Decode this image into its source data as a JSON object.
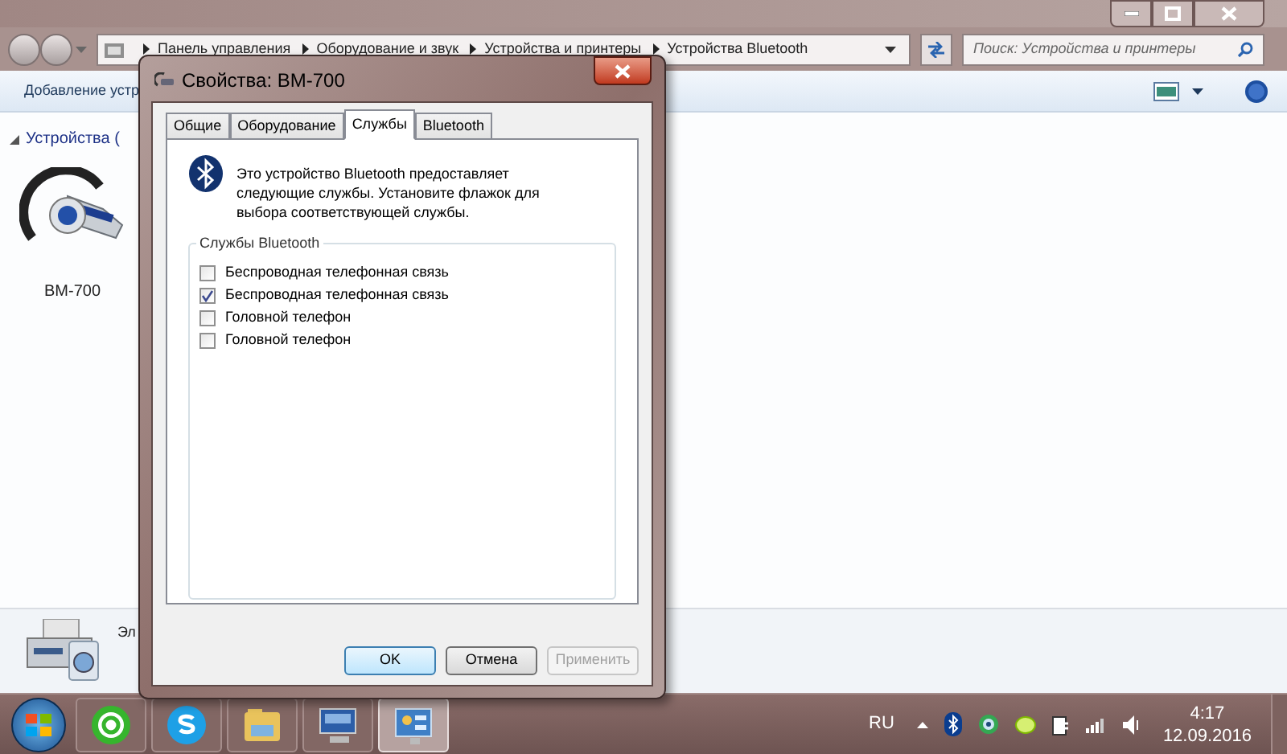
{
  "explorer": {
    "breadcrumbs": [
      "Панель управления",
      "Оборудование и звук",
      "Устройства и принтеры",
      "Устройства Bluetooth"
    ],
    "search": {
      "placeholder": "Поиск: Устройства и принтеры"
    },
    "toolbar_text": "Добавление устр",
    "group_header": "Устройства (",
    "devices": [
      {
        "label": "BM-700"
      }
    ],
    "bottom_device_label": "Эл"
  },
  "dialog": {
    "title": "Свойства: BM-700",
    "tabs": [
      {
        "label": "Общие",
        "selected": false
      },
      {
        "label": "Оборудование",
        "selected": false
      },
      {
        "label": "Службы",
        "selected": true
      },
      {
        "label": "Bluetooth",
        "selected": false
      }
    ],
    "description": "Это устройство Bluetooth предоставляет следующие службы. Установите флажок для выбора соответствующей службы.",
    "group_label": "Службы Bluetooth",
    "services": [
      {
        "label": "Беспроводная телефонная связь",
        "checked": false
      },
      {
        "label": "Беспроводная телефонная связь",
        "checked": true
      },
      {
        "label": "Головной телефон",
        "checked": false
      },
      {
        "label": "Головной телефон",
        "checked": false
      }
    ],
    "buttons": [
      {
        "label": "OK",
        "disabled": false,
        "default": true
      },
      {
        "label": "Отмена",
        "disabled": false,
        "default": false
      },
      {
        "label": "Применить",
        "disabled": true,
        "default": false
      }
    ]
  },
  "taskbar": {
    "apps": [
      {
        "selected": false
      },
      {
        "selected": false
      },
      {
        "selected": false
      },
      {
        "selected": false
      },
      {
        "selected": true
      }
    ],
    "language": "RU",
    "time": "4:17",
    "date": "12.09.2016"
  }
}
